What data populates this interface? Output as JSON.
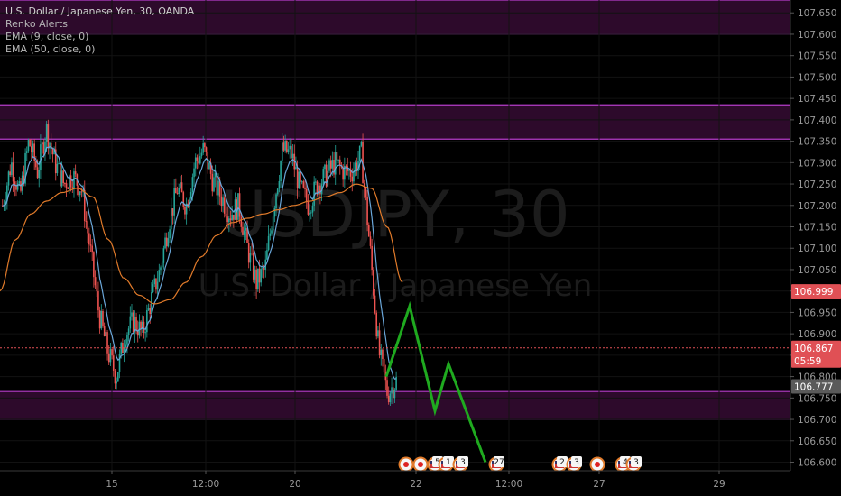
{
  "header": {
    "title": "U.S. Dollar / Japanese Yen, 30, OANDA",
    "indicators": [
      "Renko Alerts",
      "EMA (9, close, 0)",
      "EMA (50, close, 0)"
    ]
  },
  "watermark": {
    "symbol": "USDJPY, 30",
    "name": "U.S. Dollar / Japanese Yen"
  },
  "price_axis": {
    "labels": [
      "107.650",
      "107.600",
      "107.550",
      "107.500",
      "107.450",
      "107.400",
      "107.350",
      "107.300",
      "107.250",
      "107.200",
      "107.150",
      "107.100",
      "107.050",
      "107.000",
      "106.950",
      "106.900",
      "106.850",
      "106.800",
      "106.750",
      "106.700",
      "106.650",
      "106.600"
    ],
    "tags": [
      {
        "text": "106.999",
        "price": 106.999,
        "color": "#e05055"
      },
      {
        "text": "106.867",
        "price": 106.867,
        "color": "#e05055",
        "sub": "05:59"
      },
      {
        "text": "106.777",
        "price": 106.777,
        "color": "#5a5a5a"
      }
    ]
  },
  "time_axis": {
    "labels": [
      "15",
      "12:00",
      "20",
      "22",
      "12:00",
      "27",
      "29"
    ]
  },
  "events": {
    "labels": [
      "5",
      "1",
      "3",
      "27",
      "2",
      "3",
      "4",
      "3"
    ]
  },
  "colors": {
    "zone_fill": "#2d0a2b",
    "zone_line": "#b43cc8",
    "candle_up": "#26a69a",
    "candle_down": "#ef5350",
    "ema9": "#6aa6d8",
    "ema50": "#e07a2a",
    "projection": "#1faa1f",
    "current_price_line": "#e05055"
  },
  "chart_data": {
    "type": "candlestick",
    "symbol": "USDJPY",
    "timeframe": "30",
    "ylim": [
      106.58,
      107.68
    ],
    "x_tick_labels": [
      "15",
      "12:00",
      "20",
      "22",
      "12:00",
      "27",
      "29"
    ],
    "zones": [
      {
        "from": 107.6,
        "to": 107.68
      },
      {
        "from": 107.355,
        "to": 107.435
      },
      {
        "from": 106.7,
        "to": 106.765
      }
    ],
    "current_price": 106.867,
    "price_path": [
      107.2,
      107.3,
      107.22,
      107.35,
      107.28,
      107.38,
      107.3,
      107.25,
      107.27,
      107.24,
      107.1,
      106.95,
      106.86,
      106.8,
      106.9,
      106.93,
      106.9,
      106.98,
      107.05,
      107.16,
      107.24,
      107.2,
      107.3,
      107.33,
      107.26,
      107.22,
      107.18,
      107.2,
      107.1,
      107.02,
      107.05,
      107.2,
      107.33,
      107.32,
      107.24,
      107.2,
      107.25,
      107.27,
      107.3,
      107.28,
      107.28,
      107.32,
      107.1,
      106.86,
      106.76,
      106.79
    ],
    "ema50_path": [
      107.0,
      107.12,
      107.18,
      107.21,
      107.23,
      107.24,
      107.22,
      107.12,
      107.03,
      106.99,
      106.97,
      106.98,
      107.02,
      107.08,
      107.13,
      107.16,
      107.17,
      107.18,
      107.19,
      107.2,
      107.21,
      107.22,
      107.23,
      107.25,
      107.24,
      107.15,
      107.02
    ],
    "projection_path": [
      106.8,
      106.965,
      106.72,
      106.83,
      106.6
    ]
  }
}
